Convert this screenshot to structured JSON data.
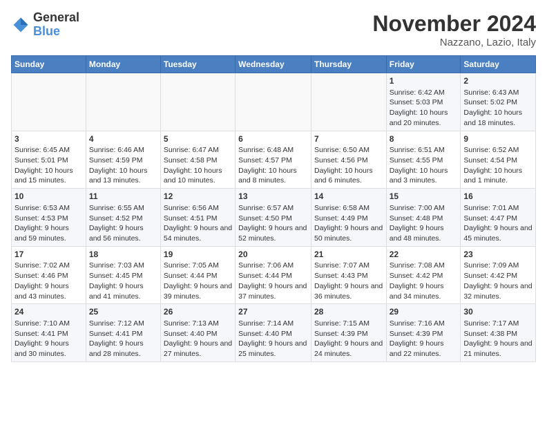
{
  "header": {
    "logo_line1": "General",
    "logo_line2": "Blue",
    "month": "November 2024",
    "location": "Nazzano, Lazio, Italy"
  },
  "days_of_week": [
    "Sunday",
    "Monday",
    "Tuesday",
    "Wednesday",
    "Thursday",
    "Friday",
    "Saturday"
  ],
  "weeks": [
    [
      {
        "day": "",
        "data": ""
      },
      {
        "day": "",
        "data": ""
      },
      {
        "day": "",
        "data": ""
      },
      {
        "day": "",
        "data": ""
      },
      {
        "day": "",
        "data": ""
      },
      {
        "day": "1",
        "data": "Sunrise: 6:42 AM\nSunset: 5:03 PM\nDaylight: 10 hours and 20 minutes."
      },
      {
        "day": "2",
        "data": "Sunrise: 6:43 AM\nSunset: 5:02 PM\nDaylight: 10 hours and 18 minutes."
      }
    ],
    [
      {
        "day": "3",
        "data": "Sunrise: 6:45 AM\nSunset: 5:01 PM\nDaylight: 10 hours and 15 minutes."
      },
      {
        "day": "4",
        "data": "Sunrise: 6:46 AM\nSunset: 4:59 PM\nDaylight: 10 hours and 13 minutes."
      },
      {
        "day": "5",
        "data": "Sunrise: 6:47 AM\nSunset: 4:58 PM\nDaylight: 10 hours and 10 minutes."
      },
      {
        "day": "6",
        "data": "Sunrise: 6:48 AM\nSunset: 4:57 PM\nDaylight: 10 hours and 8 minutes."
      },
      {
        "day": "7",
        "data": "Sunrise: 6:50 AM\nSunset: 4:56 PM\nDaylight: 10 hours and 6 minutes."
      },
      {
        "day": "8",
        "data": "Sunrise: 6:51 AM\nSunset: 4:55 PM\nDaylight: 10 hours and 3 minutes."
      },
      {
        "day": "9",
        "data": "Sunrise: 6:52 AM\nSunset: 4:54 PM\nDaylight: 10 hours and 1 minute."
      }
    ],
    [
      {
        "day": "10",
        "data": "Sunrise: 6:53 AM\nSunset: 4:53 PM\nDaylight: 9 hours and 59 minutes."
      },
      {
        "day": "11",
        "data": "Sunrise: 6:55 AM\nSunset: 4:52 PM\nDaylight: 9 hours and 56 minutes."
      },
      {
        "day": "12",
        "data": "Sunrise: 6:56 AM\nSunset: 4:51 PM\nDaylight: 9 hours and 54 minutes."
      },
      {
        "day": "13",
        "data": "Sunrise: 6:57 AM\nSunset: 4:50 PM\nDaylight: 9 hours and 52 minutes."
      },
      {
        "day": "14",
        "data": "Sunrise: 6:58 AM\nSunset: 4:49 PM\nDaylight: 9 hours and 50 minutes."
      },
      {
        "day": "15",
        "data": "Sunrise: 7:00 AM\nSunset: 4:48 PM\nDaylight: 9 hours and 48 minutes."
      },
      {
        "day": "16",
        "data": "Sunrise: 7:01 AM\nSunset: 4:47 PM\nDaylight: 9 hours and 45 minutes."
      }
    ],
    [
      {
        "day": "17",
        "data": "Sunrise: 7:02 AM\nSunset: 4:46 PM\nDaylight: 9 hours and 43 minutes."
      },
      {
        "day": "18",
        "data": "Sunrise: 7:03 AM\nSunset: 4:45 PM\nDaylight: 9 hours and 41 minutes."
      },
      {
        "day": "19",
        "data": "Sunrise: 7:05 AM\nSunset: 4:44 PM\nDaylight: 9 hours and 39 minutes."
      },
      {
        "day": "20",
        "data": "Sunrise: 7:06 AM\nSunset: 4:44 PM\nDaylight: 9 hours and 37 minutes."
      },
      {
        "day": "21",
        "data": "Sunrise: 7:07 AM\nSunset: 4:43 PM\nDaylight: 9 hours and 36 minutes."
      },
      {
        "day": "22",
        "data": "Sunrise: 7:08 AM\nSunset: 4:42 PM\nDaylight: 9 hours and 34 minutes."
      },
      {
        "day": "23",
        "data": "Sunrise: 7:09 AM\nSunset: 4:42 PM\nDaylight: 9 hours and 32 minutes."
      }
    ],
    [
      {
        "day": "24",
        "data": "Sunrise: 7:10 AM\nSunset: 4:41 PM\nDaylight: 9 hours and 30 minutes."
      },
      {
        "day": "25",
        "data": "Sunrise: 7:12 AM\nSunset: 4:41 PM\nDaylight: 9 hours and 28 minutes."
      },
      {
        "day": "26",
        "data": "Sunrise: 7:13 AM\nSunset: 4:40 PM\nDaylight: 9 hours and 27 minutes."
      },
      {
        "day": "27",
        "data": "Sunrise: 7:14 AM\nSunset: 4:40 PM\nDaylight: 9 hours and 25 minutes."
      },
      {
        "day": "28",
        "data": "Sunrise: 7:15 AM\nSunset: 4:39 PM\nDaylight: 9 hours and 24 minutes."
      },
      {
        "day": "29",
        "data": "Sunrise: 7:16 AM\nSunset: 4:39 PM\nDaylight: 9 hours and 22 minutes."
      },
      {
        "day": "30",
        "data": "Sunrise: 7:17 AM\nSunset: 4:38 PM\nDaylight: 9 hours and 21 minutes."
      }
    ]
  ]
}
